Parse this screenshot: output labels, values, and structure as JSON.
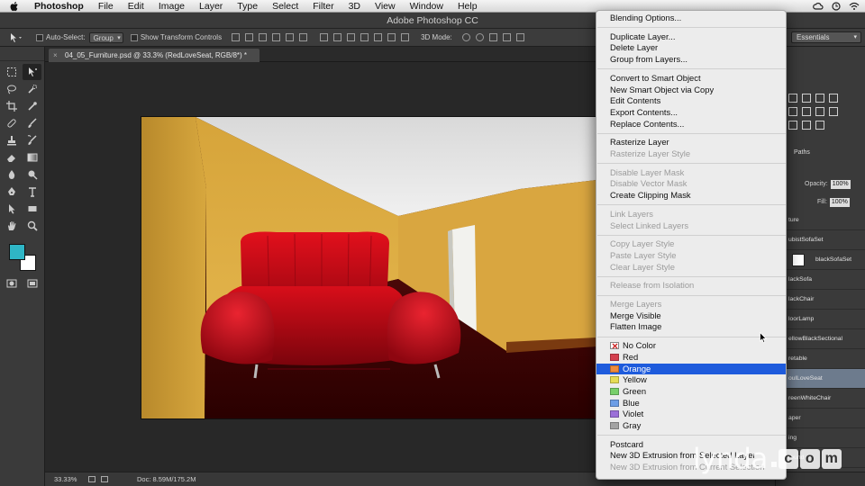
{
  "os_menubar": {
    "app_name": "Photoshop",
    "items": [
      "File",
      "Edit",
      "Image",
      "Layer",
      "Type",
      "Select",
      "Filter",
      "3D",
      "View",
      "Window",
      "Help"
    ]
  },
  "window": {
    "title": "Adobe Photoshop CC"
  },
  "options_bar": {
    "auto_select_label": "Auto-Select:",
    "auto_select_value": "Group",
    "show_transform_label": "Show Transform Controls",
    "mode_3d_label": "3D Mode:",
    "workspace": "Essentials"
  },
  "document_tab": {
    "title": "04_05_Furniture.psd @ 33.3% (RedLoveSeat, RGB/8*) *"
  },
  "status_bar": {
    "zoom": "33.33%",
    "doc_size": "Doc: 8.59M/175.2M"
  },
  "colors": {
    "foreground": "#2fb6c6",
    "background": "#ffffff",
    "menu_highlight": "#1e5bdc"
  },
  "right_panel": {
    "paths_tab": "Paths",
    "opacity_label": "Opacity:",
    "opacity_value": "100%",
    "fill_label": "Fill:",
    "fill_value": "100%",
    "layers": [
      "ture",
      "ubistSofaSet",
      "blackSofaSet",
      "lackSofa",
      "lackChair",
      "loorLamp",
      "ellowBlackSectional",
      "retable",
      "oulLoveSeat",
      "reenWhiteChair",
      "aper",
      "ing",
      "round"
    ]
  },
  "context_menu": {
    "items": [
      {
        "label": "Blending Options...",
        "disabled": false
      },
      {
        "label": "Duplicate Layer...",
        "disabled": false
      },
      {
        "label": "Delete Layer",
        "disabled": false
      },
      {
        "label": "Group from Layers...",
        "disabled": false
      },
      {
        "label": "Convert to Smart Object",
        "disabled": false
      },
      {
        "label": "New Smart Object via Copy",
        "disabled": false
      },
      {
        "label": "Edit Contents",
        "disabled": false
      },
      {
        "label": "Export Contents...",
        "disabled": false
      },
      {
        "label": "Replace Contents...",
        "disabled": false
      },
      {
        "label": "Rasterize Layer",
        "disabled": false
      },
      {
        "label": "Rasterize Layer Style",
        "disabled": true
      },
      {
        "label": "Disable Layer Mask",
        "disabled": true
      },
      {
        "label": "Disable Vector Mask",
        "disabled": true
      },
      {
        "label": "Create Clipping Mask",
        "disabled": false
      },
      {
        "label": "Link Layers",
        "disabled": true
      },
      {
        "label": "Select Linked Layers",
        "disabled": true
      },
      {
        "label": "Copy Layer Style",
        "disabled": true
      },
      {
        "label": "Paste Layer Style",
        "disabled": true
      },
      {
        "label": "Clear Layer Style",
        "disabled": true
      },
      {
        "label": "Release from Isolation",
        "disabled": true
      },
      {
        "label": "Merge Layers",
        "disabled": true
      },
      {
        "label": "Merge Visible",
        "disabled": false
      },
      {
        "label": "Flatten Image",
        "disabled": false
      },
      {
        "label": "No Color",
        "disabled": false
      },
      {
        "label": "Red",
        "disabled": false,
        "color": "#d4404e"
      },
      {
        "label": "Orange",
        "disabled": false,
        "color": "#ef8a3c",
        "highlighted": true
      },
      {
        "label": "Yellow",
        "disabled": false,
        "color": "#e6dc56"
      },
      {
        "label": "Green",
        "disabled": false,
        "color": "#78cf6a"
      },
      {
        "label": "Blue",
        "disabled": false,
        "color": "#6c9ee6"
      },
      {
        "label": "Violet",
        "disabled": false,
        "color": "#9b6fd8"
      },
      {
        "label": "Gray",
        "disabled": false,
        "color": "#a3a3a3"
      },
      {
        "label": "Postcard",
        "disabled": false
      },
      {
        "label": "New 3D Extrusion from Selected Layer",
        "disabled": false
      },
      {
        "label": "New 3D Extrusion from Current Selection",
        "disabled": true
      }
    ]
  },
  "watermark": {
    "text": "lynda",
    "suffix": "com"
  }
}
